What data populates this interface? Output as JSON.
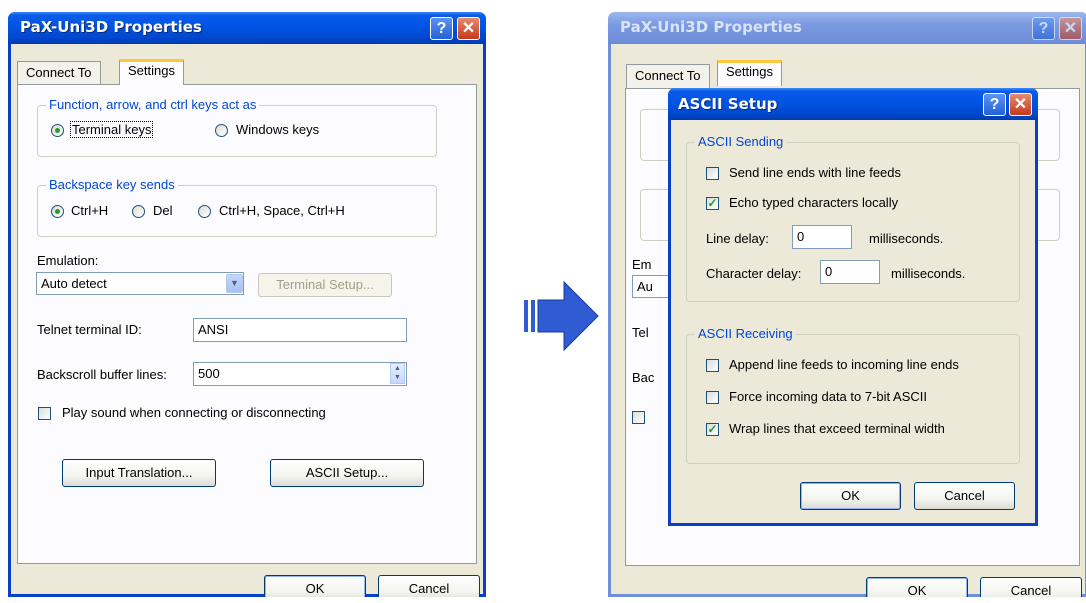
{
  "left": {
    "title": "PaX-Uni3D Properties",
    "help_glyph": "?",
    "close_glyph": "✕",
    "tabs": [
      "Connect To",
      "Settings"
    ],
    "function_group": {
      "legend": "Function, arrow, and ctrl keys act as",
      "terminal_keys": "Terminal keys",
      "windows_keys": "Windows keys"
    },
    "backspace_group": {
      "legend": "Backspace key sends",
      "ctrl_h": "Ctrl+H",
      "del": "Del",
      "ctrl_h_space": "Ctrl+H, Space, Ctrl+H"
    },
    "emulation_label": "Emulation:",
    "emulation_value": "Auto detect",
    "terminal_setup": "Terminal Setup...",
    "telnet_id_label": "Telnet terminal ID:",
    "telnet_id_value": "ANSI",
    "backscroll_label": "Backscroll buffer lines:",
    "backscroll_value": "500",
    "play_sound": "Play sound when connecting or disconnecting",
    "input_translation": "Input Translation...",
    "ascii_setup": "ASCII Setup...",
    "ok": "OK",
    "cancel": "Cancel"
  },
  "right": {
    "title": "PaX-Uni3D Properties",
    "tabs": [
      "Connect To",
      "Settings"
    ],
    "peek_emulation": "Em",
    "peek_combo": "Au",
    "peek_telnet": "Tel",
    "peek_backscroll": "Bac",
    "ok": "OK",
    "cancel": "Cancel"
  },
  "ascii_dialog": {
    "title": "ASCII Setup",
    "sending": {
      "legend": "ASCII Sending",
      "send_line_ends": "Send line ends with line feeds",
      "send_line_ends_checked": false,
      "echo_typed": "Echo typed characters locally",
      "echo_typed_checked": true,
      "line_delay_label": "Line delay:",
      "line_delay_value": "0",
      "line_delay_unit": "milliseconds.",
      "char_delay_label": "Character delay:",
      "char_delay_value": "0",
      "char_delay_unit": "milliseconds."
    },
    "receiving": {
      "legend": "ASCII Receiving",
      "append_line_feeds": "Append line feeds to incoming line ends",
      "append_checked": false,
      "force_7bit": "Force incoming data to 7-bit ASCII",
      "force_checked": false,
      "wrap_lines": "Wrap lines that exceed terminal width",
      "wrap_checked": true
    },
    "ok": "OK",
    "cancel": "Cancel",
    "check_glyph": "✓"
  },
  "colors": {
    "xp_blue": "#0054e3",
    "dialog_face": "#ece9d8",
    "arrow_blue": "#2f5bd3",
    "group_legend": "#0046d5"
  }
}
